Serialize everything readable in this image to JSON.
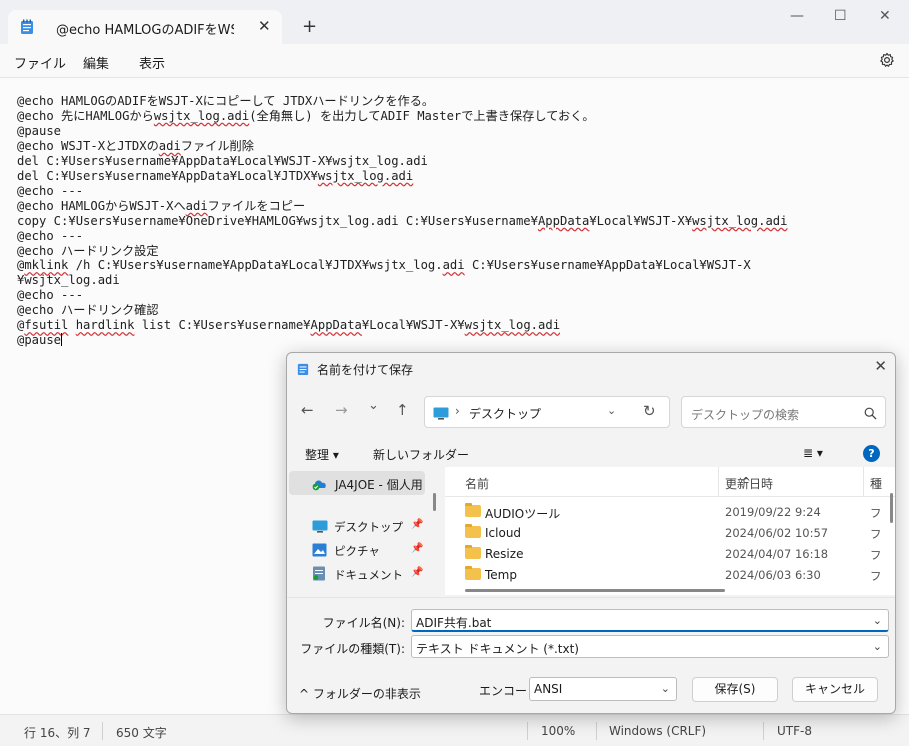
{
  "tab": {
    "title": "@echo HAMLOGのADIFをWSJT-Xに: ",
    "close": "✕",
    "new": "+"
  },
  "window": {
    "minimize": "—",
    "maximize": "☐",
    "close": "✕"
  },
  "menu": {
    "file": "ファイル",
    "edit": "編集",
    "view": "表示"
  },
  "editor": {
    "lines": [
      [
        {
          "t": "@echo HAMLOGのADIFをWSJT-Xにコピーして JTDXハードリンクを作る。"
        }
      ],
      [
        {
          "t": "@echo 先にHAMLOGから"
        },
        {
          "t": "wsjtx_log.adi",
          "sq": true
        },
        {
          "t": "(全角無し) を出力してADIF Masterで上書き保存しておく。"
        }
      ],
      [
        {
          "t": "@pause"
        }
      ],
      [
        {
          "t": "@echo WSJT-XとJTDXの"
        },
        {
          "t": "adi",
          "sq": true
        },
        {
          "t": "ファイル削除"
        }
      ],
      [
        {
          "t": "del C:¥Users¥username¥AppData¥Local¥WSJT-X¥wsjtx_log.adi"
        }
      ],
      [
        {
          "t": "del C:¥Users¥username¥AppData¥Local¥JTDX¥"
        },
        {
          "t": "wsjtx_log.adi",
          "sq": true
        }
      ],
      [
        {
          "t": "@echo ---"
        }
      ],
      [
        {
          "t": "@echo HAMLOGからWSJT-Xへ"
        },
        {
          "t": "adi",
          "sq": true
        },
        {
          "t": "ファイルをコピー"
        }
      ],
      [
        {
          "t": "copy C:¥Users¥username¥OneDrive¥HAMLOG¥wsjtx_log.adi C:¥Users¥username¥"
        },
        {
          "t": "AppData",
          "sq": true
        },
        {
          "t": "¥Local¥WSJT-X¥"
        },
        {
          "t": "wsjtx_log.adi",
          "sq": true
        }
      ],
      [
        {
          "t": "@echo ---"
        }
      ],
      [
        {
          "t": "@echo ハードリンク設定"
        }
      ],
      [
        {
          "t": "@"
        },
        {
          "t": "mklink",
          "sq": true
        },
        {
          "t": " /h C:¥Users¥username¥AppData¥Local¥JTDX¥wsjtx_log."
        },
        {
          "t": "adi",
          "sq": true
        },
        {
          "t": " C:¥Users¥username¥AppData¥Local¥WSJT-X"
        }
      ],
      [
        {
          "t": "¥wsjtx_log.adi"
        }
      ],
      [
        {
          "t": "@echo ---"
        }
      ],
      [
        {
          "t": "@echo ハードリンク確認"
        }
      ],
      [
        {
          "t": "@"
        },
        {
          "t": "fsutil",
          "sq": true
        },
        {
          "t": " "
        },
        {
          "t": "hardlink",
          "sq": true
        },
        {
          "t": " list C:¥Users¥username¥"
        },
        {
          "t": "AppData",
          "sq": true
        },
        {
          "t": "¥Local¥WSJT-X¥"
        },
        {
          "t": "wsjtx_log.adi",
          "sq": true
        }
      ],
      [
        {
          "t": "@pause"
        }
      ]
    ]
  },
  "status": {
    "position": "行 16、列 7",
    "chars": "650 文字",
    "zoom": "100%",
    "eol": "Windows (CRLF)",
    "encoding": "UTF-8"
  },
  "dialog": {
    "title": "名前を付けて保存",
    "close": "✕",
    "nav": {
      "back": "←",
      "forward": "→",
      "recent": "⌄",
      "up": "↑",
      "refresh": "↻"
    },
    "address": "デスクトップ",
    "search_placeholder": "デスクトップの検索",
    "toolbar": {
      "organize": "整理 ▾",
      "new_folder": "新しいフォルダー",
      "view": "≣  ▾",
      "help": "?"
    },
    "nav_pane": {
      "onedrive": "JA4JOE - 個人用",
      "items": [
        {
          "label": "デスクトップ"
        },
        {
          "label": "ピクチャ"
        },
        {
          "label": "ドキュメント"
        }
      ]
    },
    "columns": {
      "name": "名前",
      "date": "更新日時",
      "type": "種"
    },
    "files": [
      {
        "name": "AUDIOツール",
        "date": "2019/09/22 9:24",
        "type": "フ"
      },
      {
        "name": "Icloud",
        "date": "2024/06/02 10:57",
        "type": "フ"
      },
      {
        "name": "Resize",
        "date": "2024/04/07 16:18",
        "type": "フ"
      },
      {
        "name": "Temp",
        "date": "2024/06/03 6:30",
        "type": "フ"
      }
    ],
    "filename_label": "ファイル名(N):",
    "filename_value": "ADIF共有.bat",
    "filetype_label": "ファイルの種類(T):",
    "filetype_value": "テキスト ドキュメント (*.txt)",
    "hide_folders": "フォルダーの非表示",
    "encoding_label": "エンコード:",
    "encoding_value": "ANSI",
    "save_button": "保存(S)",
    "cancel_button": "キャンセル"
  }
}
